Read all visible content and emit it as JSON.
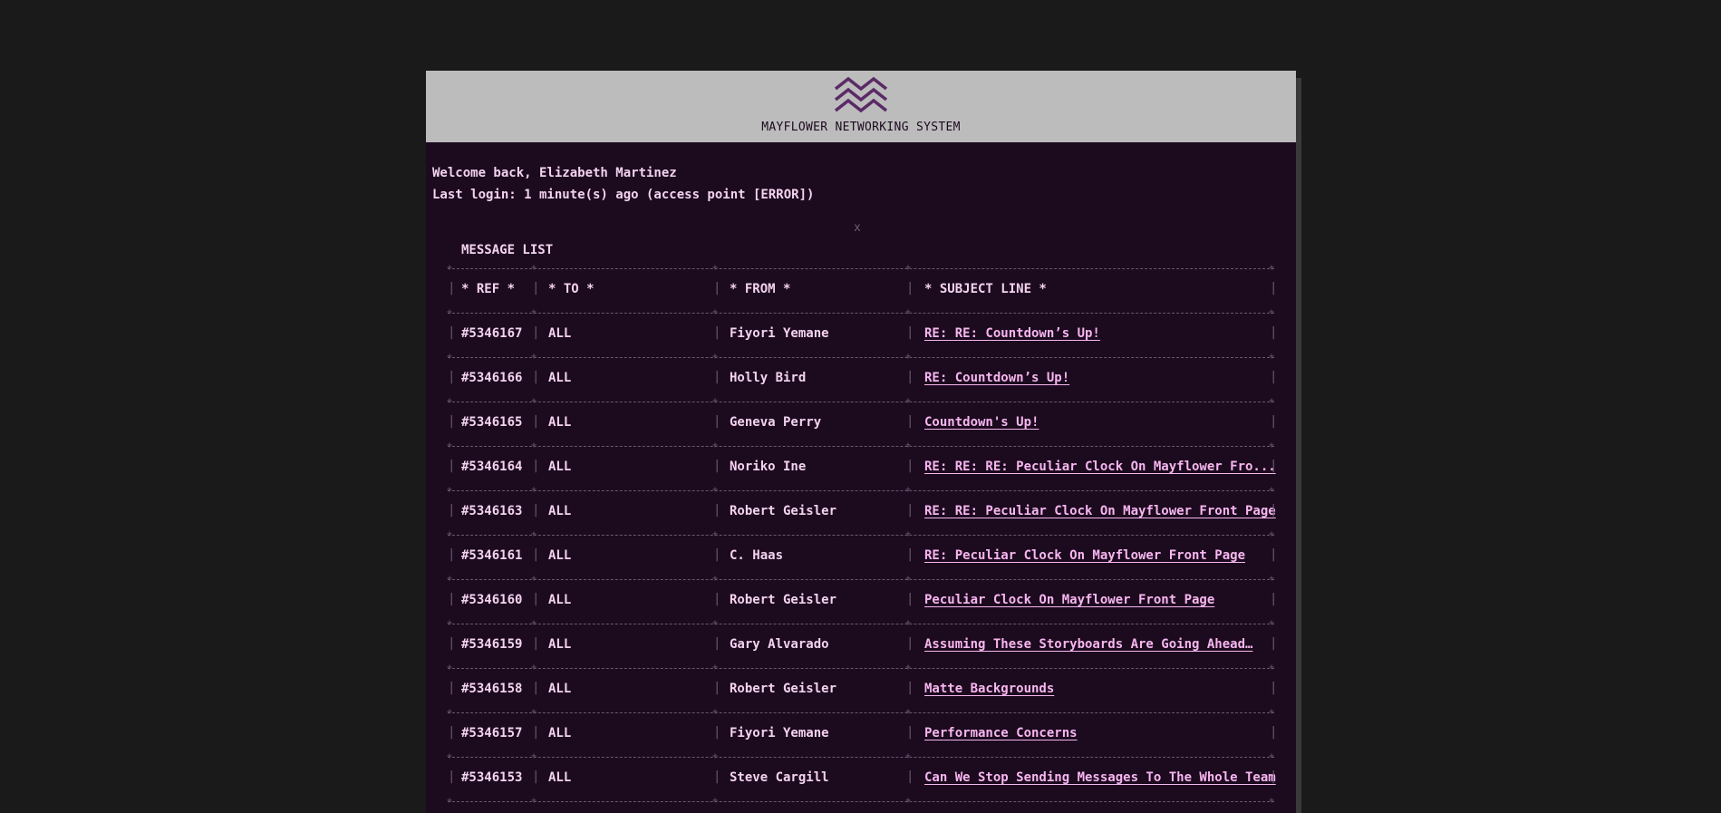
{
  "header": {
    "system_title": "MAYFLOWER NETWORKING SYSTEM",
    "logo_icon": "triple-chevron-up-icon"
  },
  "welcome": {
    "line1": "Welcome back, Elizabeth Martinez",
    "line2": "Last login: 1 minute(s) ago (access point [ERROR])"
  },
  "close_label": "x",
  "message_list": {
    "title": "MESSAGE LIST",
    "columns": {
      "ref": "* REF *",
      "to": "* TO *",
      "from": "* FROM *",
      "subject": "* SUBJECT LINE *"
    },
    "rows": [
      {
        "ref": "#5346167",
        "to": "ALL",
        "from": "Fiyori Yemane",
        "subject": "RE: RE: Countdown’s Up!"
      },
      {
        "ref": "#5346166",
        "to": "ALL",
        "from": "Holly Bird",
        "subject": "RE: Countdown’s Up! "
      },
      {
        "ref": "#5346165",
        "to": "ALL",
        "from": "Geneva Perry",
        "subject": "Countdown's Up!"
      },
      {
        "ref": "#5346164",
        "to": "ALL",
        "from": "Noriko Ine",
        "subject": "RE: RE: RE: Peculiar Clock On Mayflower Fro..."
      },
      {
        "ref": "#5346163",
        "to": "ALL",
        "from": "Robert Geisler",
        "subject": "RE: RE: Peculiar Clock On Mayflower Front Page"
      },
      {
        "ref": "#5346161",
        "to": "ALL",
        "from": "C. Haas",
        "subject": "RE: Peculiar Clock On Mayflower Front Page"
      },
      {
        "ref": "#5346160",
        "to": "ALL",
        "from": "Robert Geisler",
        "subject": "Peculiar Clock On Mayflower Front Page"
      },
      {
        "ref": "#5346159",
        "to": "ALL",
        "from": "Gary Alvarado",
        "subject": "Assuming These Storyboards Are Going Ahead…"
      },
      {
        "ref": "#5346158",
        "to": "ALL",
        "from": "Robert Geisler",
        "subject": "Matte Backgrounds"
      },
      {
        "ref": "#5346157",
        "to": "ALL",
        "from": "Fiyori Yemane",
        "subject": "Performance Concerns"
      },
      {
        "ref": "#5346153",
        "to": "ALL",
        "from": "Steve Cargill",
        "subject": "Can We Stop Sending Messages To The Whole Team"
      }
    ]
  },
  "colors": {
    "page_bg": "#1a1a1a",
    "window_bg": "#1c0a1f",
    "header_bg": "#bcbcbc",
    "text": "#f3d3ef",
    "link": "#f7b6ef",
    "border": "#6b5670",
    "logo": "#5a2a66"
  }
}
